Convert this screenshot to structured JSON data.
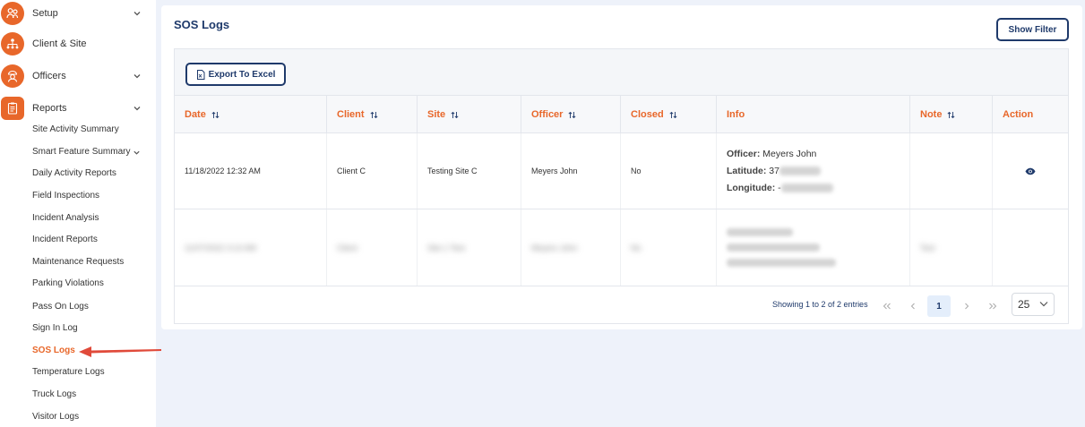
{
  "sidebar": {
    "items": [
      {
        "label": "Setup",
        "icon": "setup-icon",
        "has_chevron": true
      },
      {
        "label": "Client & Site",
        "icon": "client-site-icon",
        "has_chevron": false
      },
      {
        "label": "Officers",
        "icon": "officer-icon",
        "has_chevron": true
      },
      {
        "label": "Reports",
        "icon": "reports-icon",
        "has_chevron": true
      }
    ],
    "reports_submenu": [
      "Site Activity Summary",
      "Smart Feature Summary",
      "Daily Activity Reports",
      "Field Inspections",
      "Incident Analysis",
      "Incident Reports",
      "Maintenance Requests",
      "Parking Violations",
      "Pass On Logs",
      "Sign In Log",
      "SOS Logs",
      "Temperature Logs",
      "Truck Logs",
      "Visitor Logs"
    ],
    "active_item": "SOS Logs",
    "accent_color": "#e8672a"
  },
  "page": {
    "title": "SOS Logs",
    "show_filter_label": "Show Filter",
    "export_label": "Export To Excel"
  },
  "table": {
    "columns": [
      "Date",
      "Client",
      "Site",
      "Officer",
      "Closed",
      "Info",
      "Note",
      "Action"
    ],
    "rows": [
      {
        "date": "11/18/2022 12:32 AM",
        "client": "Client C",
        "site": "Testing Site C",
        "officer": "Meyers John",
        "closed": "No",
        "info": {
          "officer_key": "Officer:",
          "officer_val": "Meyers John",
          "lat_key": "Latitude:",
          "lat_val": "37",
          "lon_key": "Longitude:",
          "lon_val": "-"
        },
        "note": "",
        "action_icon": "eye-icon"
      },
      {
        "date": "11/07/2022 3:13 AM",
        "client": "Client",
        "site": "Site 1 Test",
        "officer": "Meyers John",
        "closed": "No",
        "note": "Test",
        "blurred": true
      }
    ]
  },
  "pagination": {
    "showing_text": "Showing 1 to 2 of 2 entries",
    "current_page": "1",
    "page_size": "25"
  },
  "colors": {
    "navy": "#1f3a6b",
    "orange": "#e8672a",
    "background": "#eef2fa"
  }
}
